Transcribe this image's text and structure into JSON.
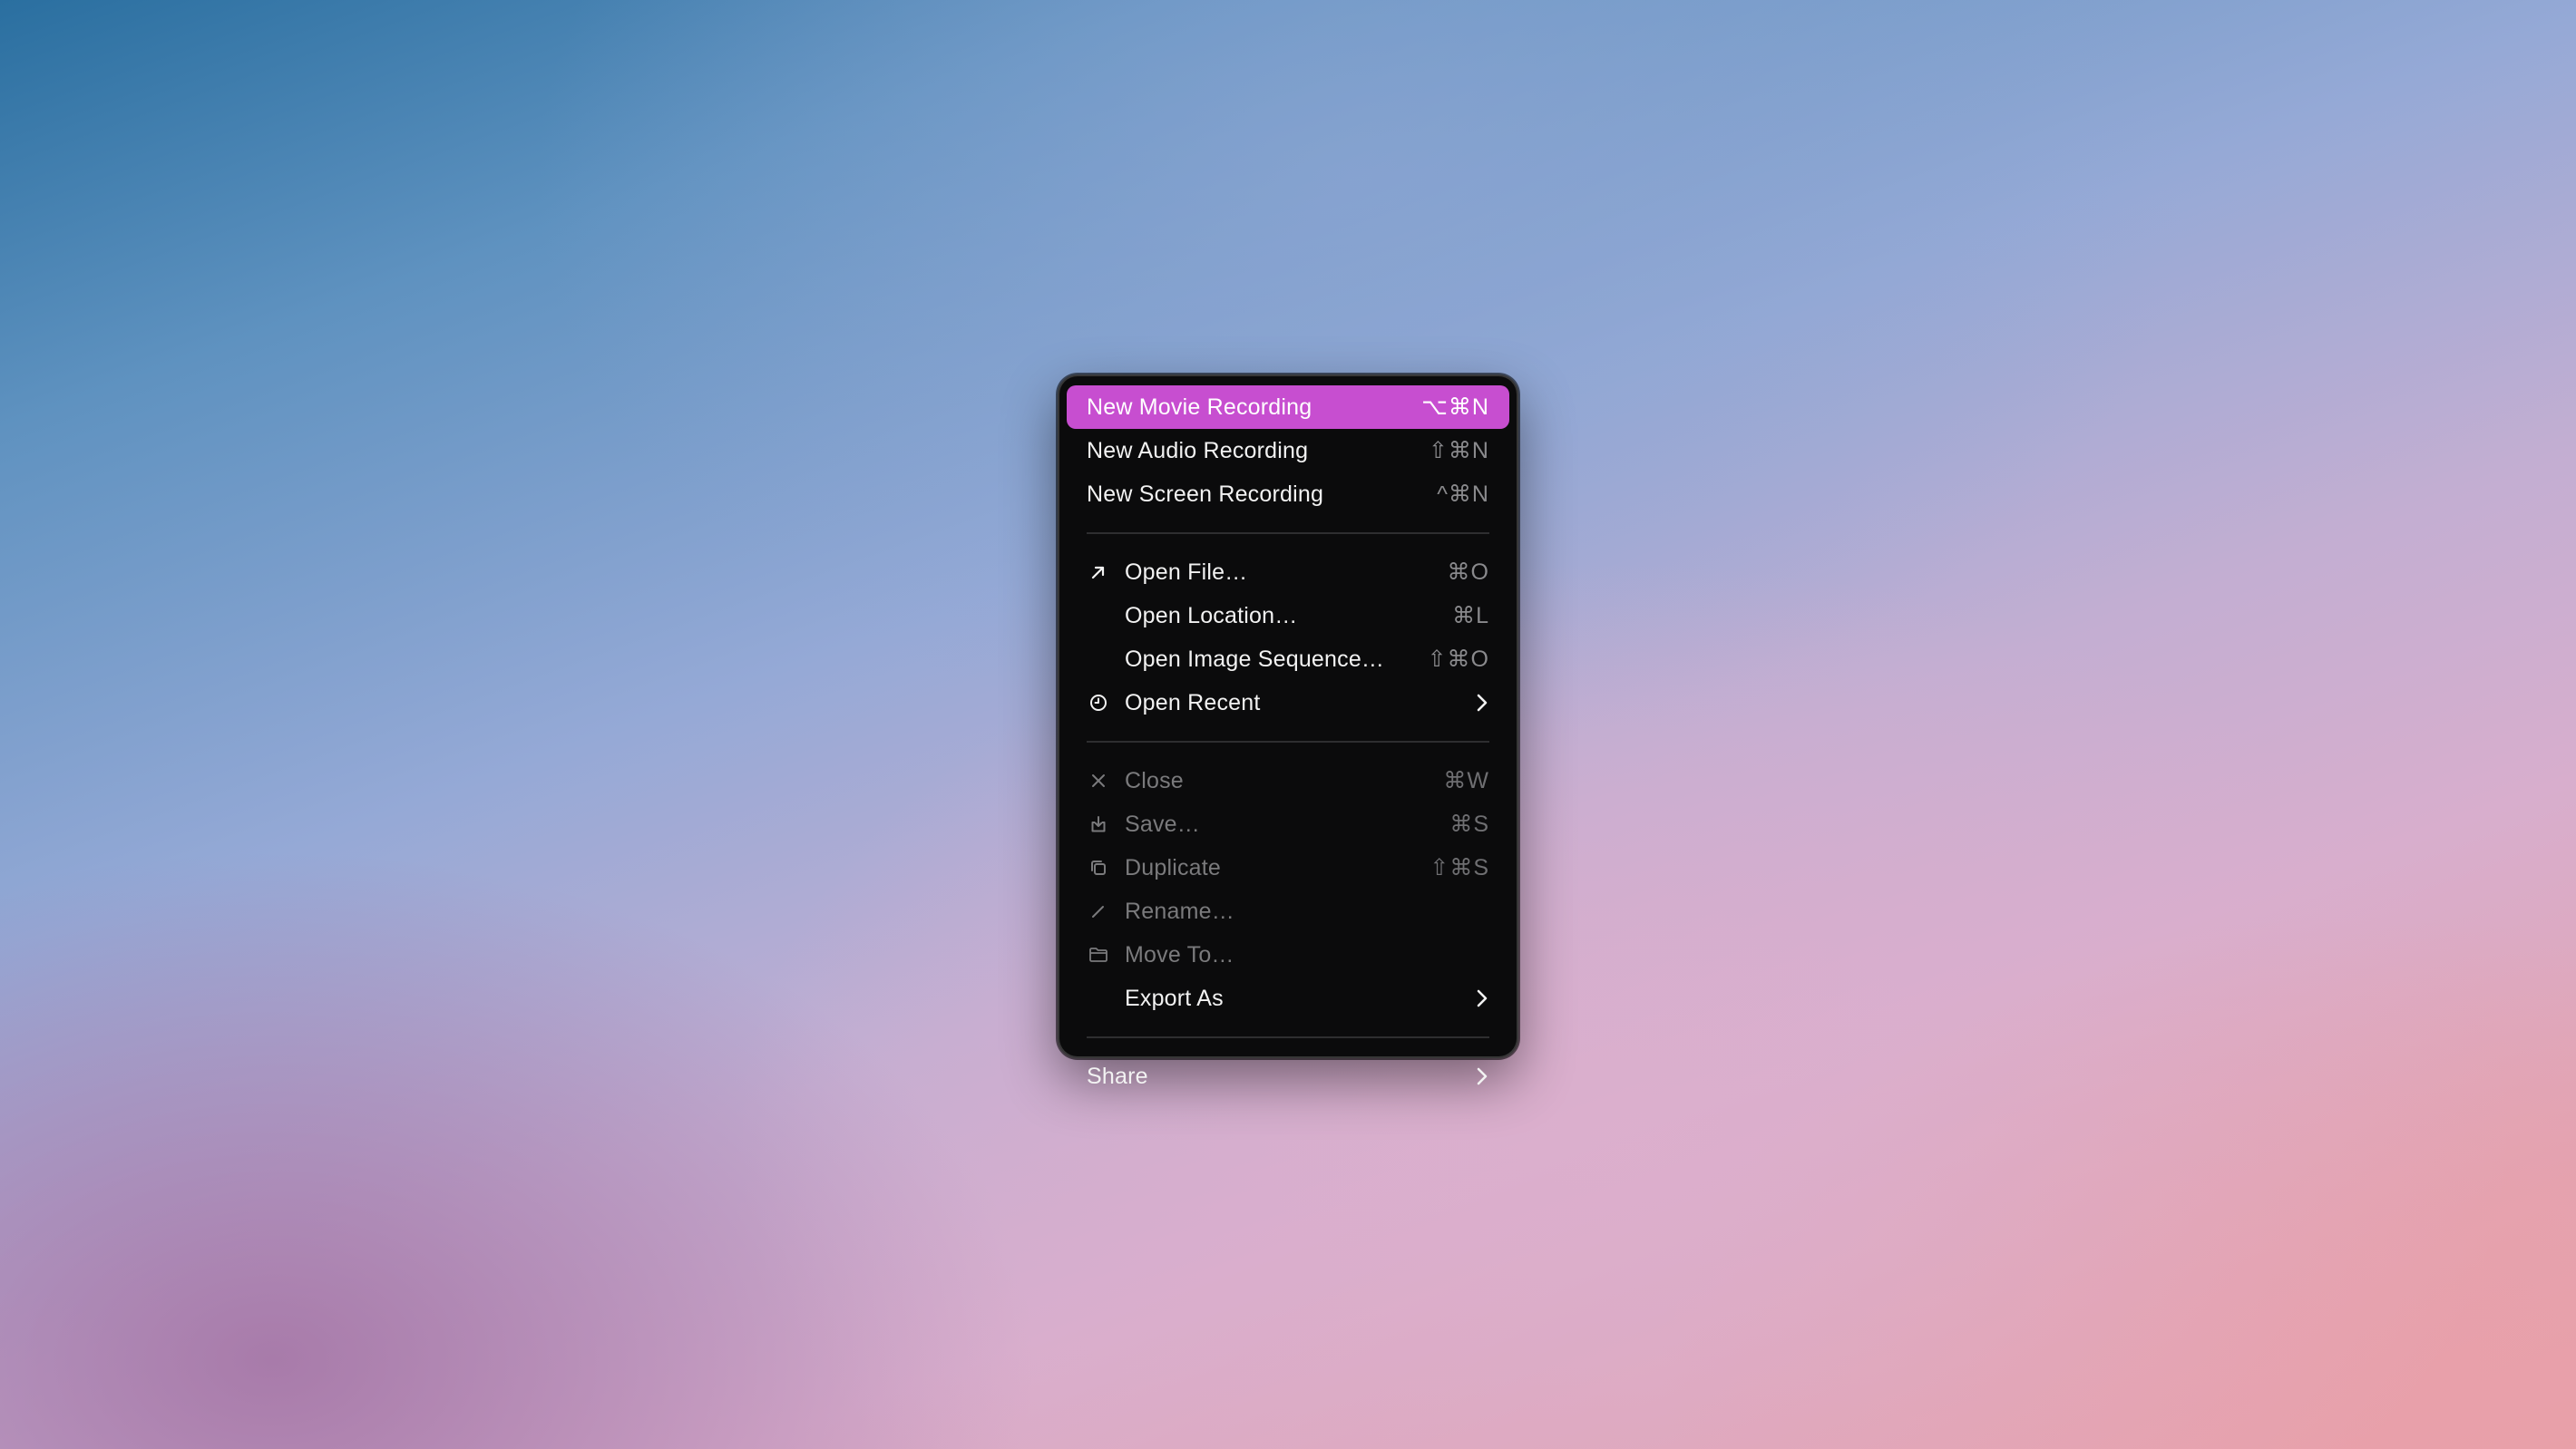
{
  "menu": {
    "items": [
      {
        "label": "New Movie Recording",
        "shortcut": "⌥⌘N"
      },
      {
        "label": "New Audio Recording",
        "shortcut": "⇧⌘N"
      },
      {
        "label": "New Screen Recording",
        "shortcut": "^⌘N"
      },
      {
        "label": "Open File…",
        "shortcut": "⌘O",
        "icon": "arrow-up-right-icon"
      },
      {
        "label": "Open Location…",
        "shortcut": "⌘L"
      },
      {
        "label": "Open Image Sequence…",
        "shortcut": "⇧⌘O"
      },
      {
        "label": "Open Recent",
        "icon": "clock-icon",
        "submenu_icon": "chevron-right-icon"
      },
      {
        "label": "Close",
        "shortcut": "⌘W",
        "icon": "close-icon"
      },
      {
        "label": "Save…",
        "shortcut": "⌘S",
        "icon": "save-icon"
      },
      {
        "label": "Duplicate",
        "shortcut": "⇧⌘S",
        "icon": "duplicate-icon"
      },
      {
        "label": "Rename…",
        "icon": "pencil-icon"
      },
      {
        "label": "Move To…",
        "icon": "folder-icon"
      },
      {
        "label": "Export As",
        "submenu_icon": "chevron-right-icon"
      },
      {
        "label": "Share",
        "submenu_icon": "chevron-right-icon"
      }
    ]
  },
  "colors": {
    "highlight": "#c74ed0",
    "menu_background": "#0b0b0c",
    "disabled_text": "#7a7a7c"
  }
}
